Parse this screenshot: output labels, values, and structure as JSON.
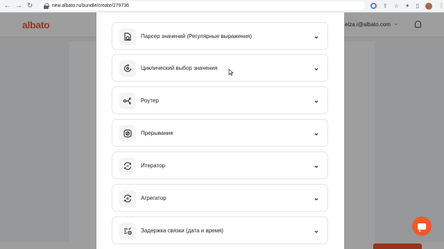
{
  "browser": {
    "url": "new.albato.ru/bundle/create/279736"
  },
  "header": {
    "logo": "albato",
    "user_email": "elza.i@albato.com"
  },
  "modal": {
    "items": [
      {
        "label": "Парсер значений (Регулярные выражения)",
        "icon": "regex-parser-icon"
      },
      {
        "label": "Циклический выбор значения",
        "icon": "cyclic-select-icon"
      },
      {
        "label": "Роутер",
        "icon": "router-icon"
      },
      {
        "label": "Прерывание",
        "icon": "interrupt-icon"
      },
      {
        "label": "Итератор",
        "icon": "iterator-icon"
      },
      {
        "label": "Агрегатор",
        "icon": "aggregator-icon"
      },
      {
        "label": "Задержка связки (дата и время)",
        "icon": "delay-icon"
      }
    ]
  },
  "colors": {
    "brand": "#f0592a",
    "overlay": "rgba(0,0,0,0.38)"
  }
}
